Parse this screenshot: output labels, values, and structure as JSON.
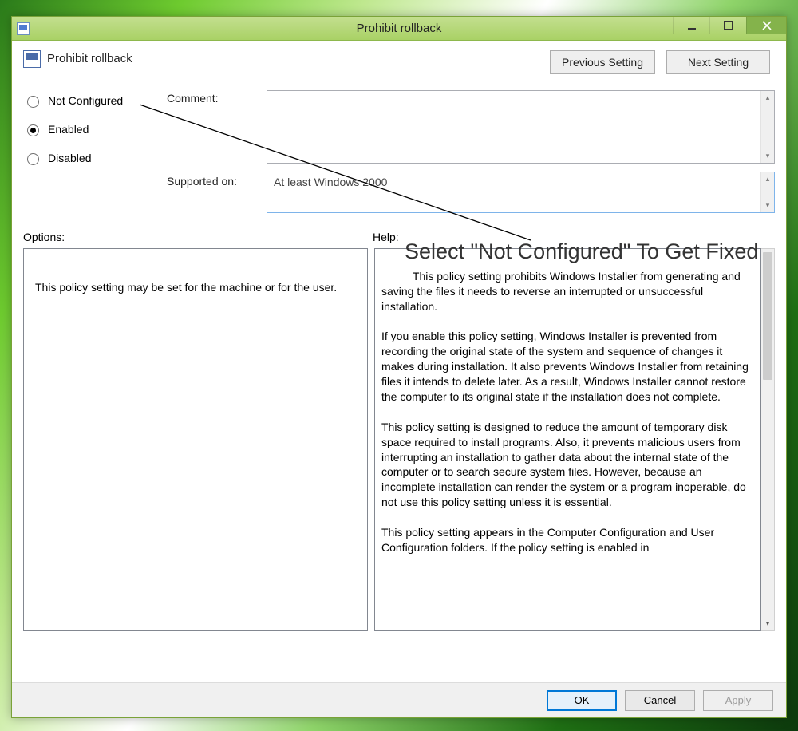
{
  "window": {
    "title": "Prohibit rollback",
    "policy_name": "Prohibit rollback"
  },
  "nav": {
    "previous": "Previous Setting",
    "next": "Next Setting"
  },
  "state": {
    "not_configured": "Not Configured",
    "enabled": "Enabled",
    "disabled": "Disabled",
    "selected": "enabled"
  },
  "fields": {
    "comment_label": "Comment:",
    "comment_value": "",
    "supported_label": "Supported on:",
    "supported_value": "At least Windows 2000"
  },
  "labels": {
    "options": "Options:",
    "help": "Help:"
  },
  "options_text": "This policy setting may be set for the machine or for the user.",
  "help_text": "This policy setting prohibits Windows Installer from generating and saving the files it needs to reverse an interrupted or unsuccessful installation.\n\nIf you enable this policy setting, Windows Installer is prevented from recording the original state of the system and sequence of changes it makes during installation. It also prevents Windows Installer from retaining files it intends to delete later. As a result, Windows Installer cannot restore the computer to its original state if the installation does not complete.\n\nThis policy setting is designed to reduce the amount of temporary disk space required to install programs. Also, it prevents malicious users from interrupting an installation to gather data about the internal state of the computer or to search secure system files. However, because an incomplete installation can render the system or a program inoperable, do not use this policy setting unless it is essential.\n\nThis policy setting appears in the Computer Configuration and User Configuration folders. If the policy setting is enabled in",
  "buttons": {
    "ok": "OK",
    "cancel": "Cancel",
    "apply": "Apply"
  },
  "annotation": "Select \"Not Configured\" To Get Fixed"
}
